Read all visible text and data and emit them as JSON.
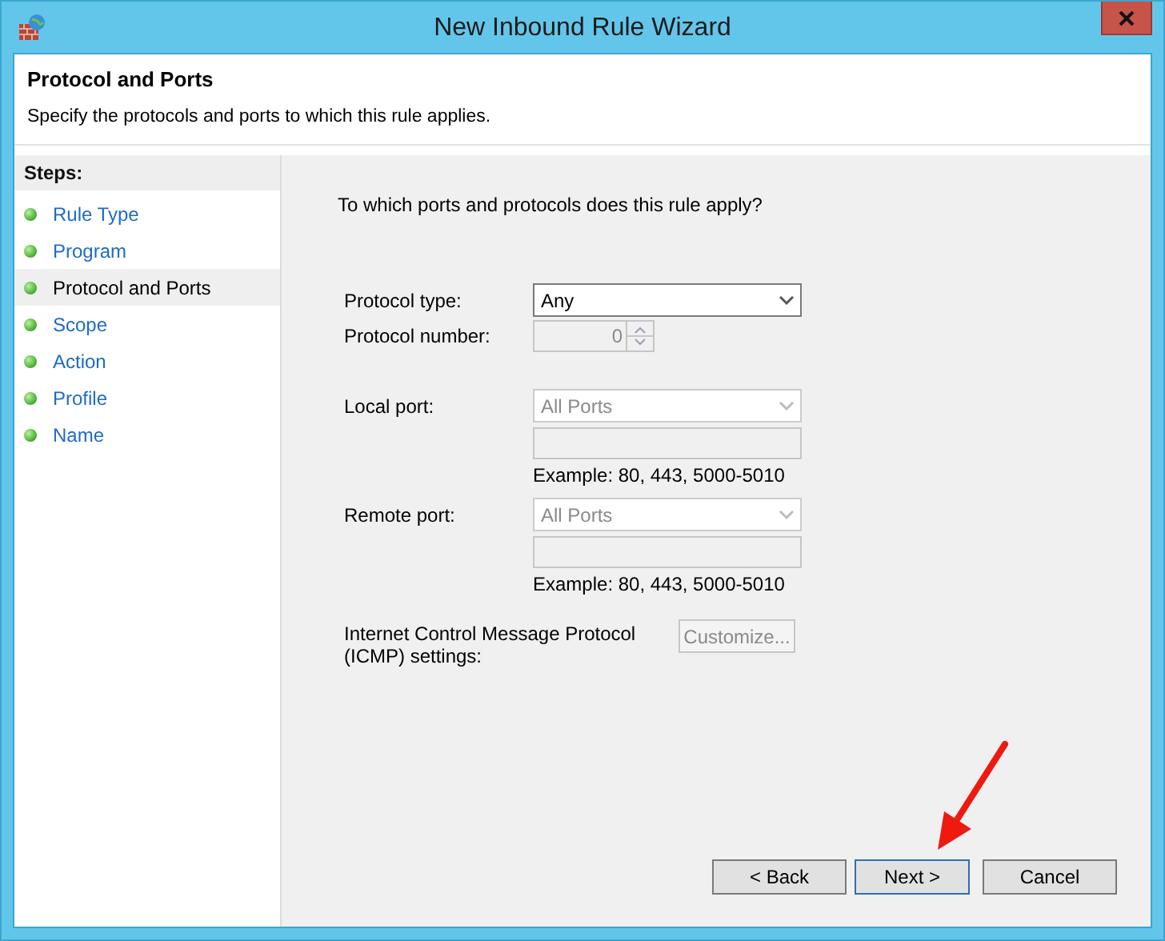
{
  "window": {
    "title": "New Inbound Rule Wizard"
  },
  "header": {
    "title": "Protocol and Ports",
    "subtitle": "Specify the protocols and ports to which this rule applies."
  },
  "steps": {
    "heading": "Steps:",
    "items": [
      {
        "label": "Rule Type",
        "selected": false
      },
      {
        "label": "Program",
        "selected": false
      },
      {
        "label": "Protocol and Ports",
        "selected": true
      },
      {
        "label": "Scope",
        "selected": false
      },
      {
        "label": "Action",
        "selected": false
      },
      {
        "label": "Profile",
        "selected": false
      },
      {
        "label": "Name",
        "selected": false
      }
    ]
  },
  "form": {
    "question": "To which ports and protocols does this rule apply?",
    "protocol_type": {
      "label": "Protocol type:",
      "value": "Any",
      "disabled": false
    },
    "protocol_number": {
      "label": "Protocol number:",
      "value": "0",
      "disabled": true
    },
    "ports": [
      {
        "label": "Local port:",
        "value": "All Ports",
        "disabled": true,
        "example": "Example: 80, 443, 5000-5010"
      },
      {
        "label": "Remote port:",
        "value": "All Ports",
        "disabled": true,
        "example": "Example: 80, 443, 5000-5010"
      }
    ],
    "icmp": {
      "label": "Internet Control Message Protocol (ICMP) settings:",
      "button": "Customize...",
      "disabled": true
    }
  },
  "buttons": [
    {
      "label": "< Back",
      "default": false
    },
    {
      "label": "Next >",
      "default": true
    },
    {
      "label": "Cancel",
      "default": false
    }
  ]
}
